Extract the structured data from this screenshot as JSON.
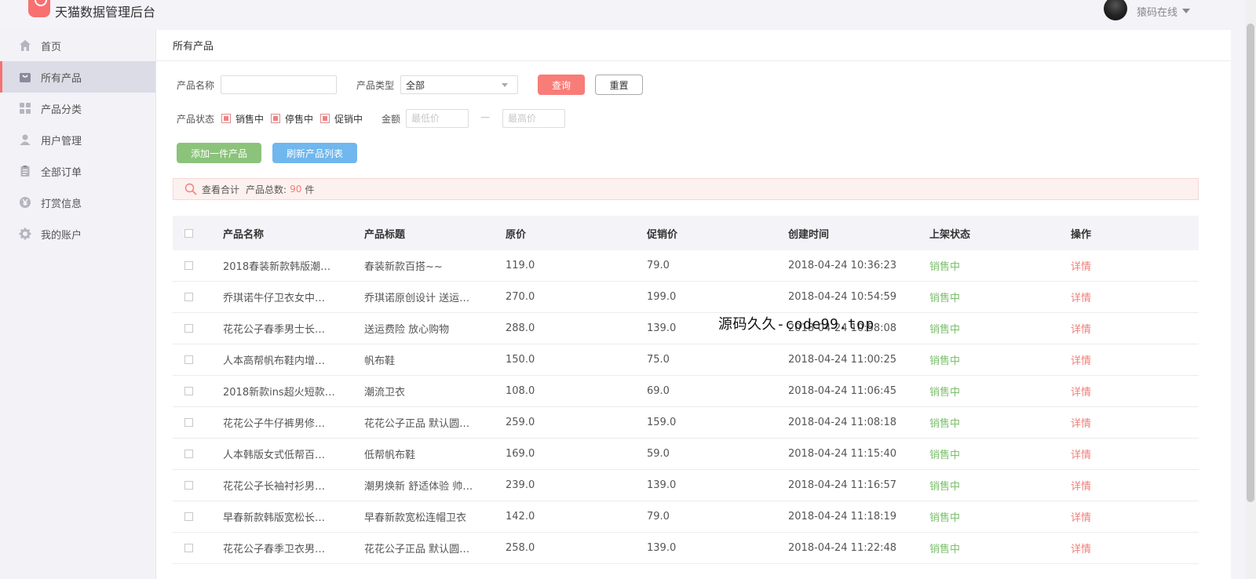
{
  "header": {
    "app_title": "天猫数据管理后台",
    "user_name": "猿码在线"
  },
  "sidebar": {
    "items": [
      {
        "label": "首页",
        "icon": "home-icon"
      },
      {
        "label": "所有产品",
        "icon": "bag-icon",
        "active": true
      },
      {
        "label": "产品分类",
        "icon": "grid-icon"
      },
      {
        "label": "用户管理",
        "icon": "user-icon"
      },
      {
        "label": "全部订单",
        "icon": "clipboard-icon"
      },
      {
        "label": "打赏信息",
        "icon": "yen-icon"
      },
      {
        "label": "我的账户",
        "icon": "gear-icon"
      }
    ]
  },
  "page": {
    "title": "所有产品"
  },
  "filters": {
    "name_label": "产品名称",
    "name_value": "",
    "type_label": "产品类型",
    "type_value": "全部",
    "query_button": "查询",
    "reset_button": "重置",
    "status_label": "产品状态",
    "status_options": [
      "销售中",
      "停售中",
      "促销中"
    ],
    "amount_label": "金额",
    "min_placeholder": "最低价",
    "max_placeholder": "最高价",
    "range_separator": "—",
    "add_button": "添加一件产品",
    "refresh_button": "刷新产品列表"
  },
  "summary": {
    "label": "查看合计",
    "total_label": "产品总数:",
    "total_count": "90",
    "unit": "件"
  },
  "table": {
    "columns": [
      "产品名称",
      "产品标题",
      "原价",
      "促销价",
      "创建时间",
      "上架状态",
      "操作"
    ],
    "rows": [
      {
        "name": "2018春装新款韩版潮…",
        "title": "春装新款百搭~~",
        "price": "119.0",
        "promo": "79.0",
        "time": "2018-04-24 10:36:23",
        "status": "销售中",
        "op": "详情"
      },
      {
        "name": "乔琪诺牛仔卫衣女中…",
        "title": "乔琪诺原创设计 送运…",
        "price": "270.0",
        "promo": "199.0",
        "time": "2018-04-24 10:54:59",
        "status": "销售中",
        "op": "详情"
      },
      {
        "name": "花花公子春季男士长…",
        "title": "送运费险 放心购物",
        "price": "288.0",
        "promo": "139.0",
        "time": "2018-04-24 10:58:08",
        "status": "销售中",
        "op": "详情"
      },
      {
        "name": "人本高帮帆布鞋内增…",
        "title": "帆布鞋",
        "price": "150.0",
        "promo": "75.0",
        "time": "2018-04-24 11:00:25",
        "status": "销售中",
        "op": "详情"
      },
      {
        "name": "2018新款ins超火短款…",
        "title": "潮流卫衣",
        "price": "108.0",
        "promo": "69.0",
        "time": "2018-04-24 11:06:45",
        "status": "销售中",
        "op": "详情"
      },
      {
        "name": "花花公子牛仔裤男修…",
        "title": "花花公子正品 默认圆…",
        "price": "259.0",
        "promo": "159.0",
        "time": "2018-04-24 11:08:18",
        "status": "销售中",
        "op": "详情"
      },
      {
        "name": "人本韩版女式低帮百…",
        "title": "低帮帆布鞋",
        "price": "169.0",
        "promo": "59.0",
        "time": "2018-04-24 11:15:40",
        "status": "销售中",
        "op": "详情"
      },
      {
        "name": "花花公子长袖衬衫男…",
        "title": "潮男焕新 舒适体验 帅…",
        "price": "239.0",
        "promo": "139.0",
        "time": "2018-04-24 11:16:57",
        "status": "销售中",
        "op": "详情"
      },
      {
        "name": "早春新款韩版宽松长…",
        "title": "早春新款宽松连帽卫衣",
        "price": "142.0",
        "promo": "79.0",
        "time": "2018-04-24 11:18:19",
        "status": "销售中",
        "op": "详情"
      },
      {
        "name": "花花公子春季卫衣男…",
        "title": "花花公子正品 默认圆…",
        "price": "258.0",
        "promo": "139.0",
        "time": "2018-04-24 11:22:48",
        "status": "销售中",
        "op": "详情"
      }
    ]
  },
  "watermark": "源码久久-code99.top",
  "colors": {
    "accent": "#f87c78",
    "success": "#7bbf6b",
    "add_button": "#8bc37a",
    "refresh_button": "#6fb7ee"
  }
}
